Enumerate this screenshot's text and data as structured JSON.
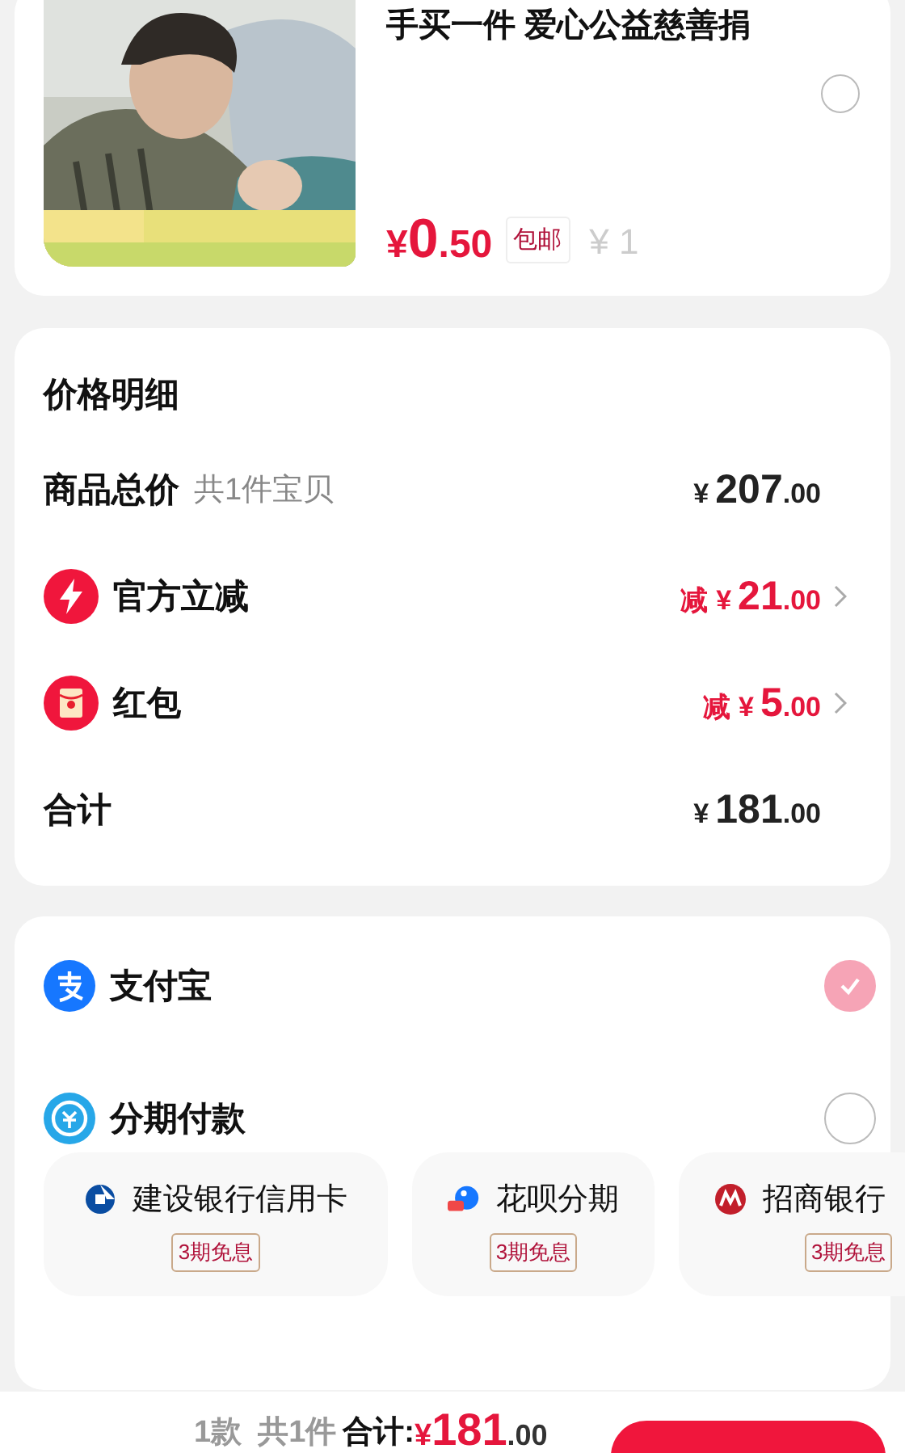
{
  "product": {
    "title": "手买一件 爱心公益慈善捐",
    "selected": false,
    "price_symbol": "¥",
    "price_int": "0",
    "price_dec": ".50",
    "shipping_tag": "包邮",
    "original_price": "¥ 1"
  },
  "price_detail": {
    "title": "价格明细",
    "rows": [
      {
        "kind": "subtotal",
        "label": "商品总价",
        "note": "共1件宝贝",
        "prefix": "",
        "symbol": "¥",
        "amount_int": "207",
        "amount_dec": ".00"
      },
      {
        "kind": "flash",
        "label": "官方立减",
        "note": "",
        "prefix": "减",
        "symbol": "¥",
        "amount_int": "21",
        "amount_dec": ".00"
      },
      {
        "kind": "packet",
        "label": "红包",
        "note": "",
        "prefix": "减",
        "symbol": "¥",
        "amount_int": "5",
        "amount_dec": ".00"
      },
      {
        "kind": "total",
        "label": "合计",
        "note": "",
        "prefix": "",
        "symbol": "¥",
        "amount_int": "181",
        "amount_dec": ".00"
      }
    ]
  },
  "payments": [
    {
      "kind": "alipay",
      "label": "支付宝",
      "selected": true
    },
    {
      "kind": "installment",
      "label": "分期付款",
      "selected": false
    }
  ],
  "plans": [
    {
      "kind": "ccb",
      "label": "建设银行信用卡",
      "tag": "3期免息"
    },
    {
      "kind": "huabei",
      "label": "花呗分期",
      "tag": "3期免息"
    },
    {
      "kind": "cmb",
      "label": "招商银行",
      "tag": "3期免息"
    }
  ],
  "bottom_bar": {
    "styles": "1款",
    "count": "共1件",
    "total_label": "合计:",
    "symbol": "¥",
    "total_int": "181",
    "total_dec": ".00"
  }
}
